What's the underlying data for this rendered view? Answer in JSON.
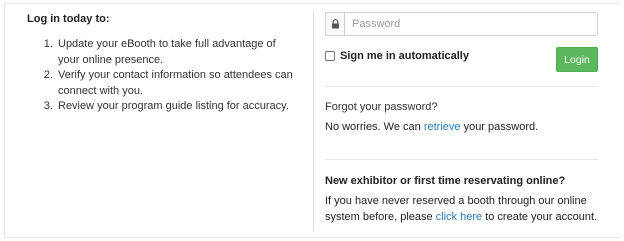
{
  "left": {
    "title": "Log in today to:",
    "steps": [
      "Update your eBooth to take full advantage of your online presence.",
      "Verify your contact information so attendees can connect with you.",
      "Review your program guide listing for accuracy."
    ]
  },
  "login": {
    "password_placeholder": "Password",
    "password_value": "",
    "lock_icon": "lock-icon",
    "remember_label": "Sign me in automatically",
    "remember_checked": false,
    "login_button": "Login"
  },
  "forgot": {
    "title": "Forgot your password?",
    "text_before": "No worries.  We can ",
    "link": "retrieve",
    "text_after": " your password."
  },
  "new_exhibitor": {
    "title": "New exhibitor or first time reservating online?",
    "text_before": "If you have never reserved a booth through our online system before, please ",
    "link": "click here",
    "text_after": " to create your account."
  },
  "colors": {
    "login_button": "#5cb85c",
    "link": "#2a7ab8"
  }
}
